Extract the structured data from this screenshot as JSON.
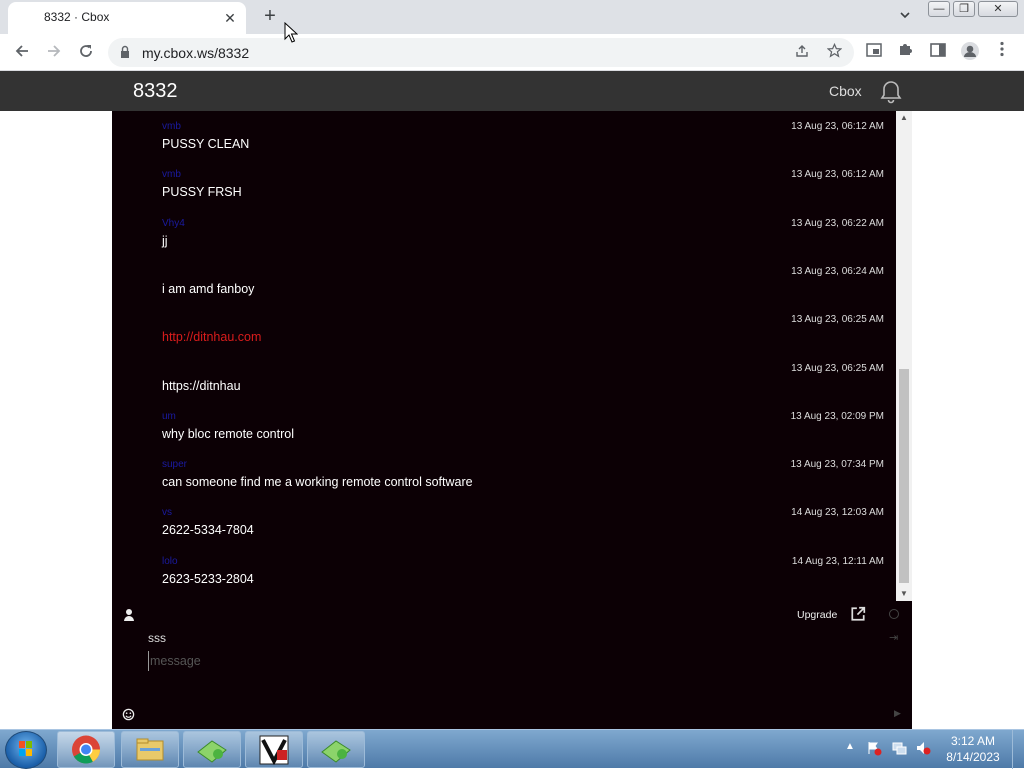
{
  "browser": {
    "tab_title": "8332 · Cbox",
    "tab_close": "✕",
    "new_tab": "+",
    "tab_search": "⌄",
    "url": "my.cbox.ws/8332",
    "window_controls": [
      "—",
      "❐",
      "✕"
    ]
  },
  "site": {
    "title": "8332",
    "brand": "Cbox"
  },
  "messages": [
    {
      "name": "vmb",
      "time": "13 Aug 23, 06:12 AM",
      "text": "PUSSY CLEAN",
      "is_link": false
    },
    {
      "name": "vmb",
      "time": "13 Aug 23, 06:12 AM",
      "text": "PUSSY FRSH",
      "is_link": false
    },
    {
      "name": "Vhy4",
      "time": "13 Aug 23, 06:22 AM",
      "text": "jj",
      "is_link": false
    },
    {
      "name": "",
      "time": "13 Aug 23, 06:24 AM",
      "text": "i am amd fanboy",
      "is_link": false
    },
    {
      "name": "",
      "time": "13 Aug 23, 06:25 AM",
      "text": "http://ditnhau.com",
      "is_link": true
    },
    {
      "name": "",
      "time": "13 Aug 23, 06:25 AM",
      "text": "https://ditnhau",
      "is_link": false
    },
    {
      "name": "um",
      "time": "13 Aug 23, 02:09 PM",
      "text": "why bloc remote control",
      "is_link": false
    },
    {
      "name": "super",
      "time": "13 Aug 23, 07:34 PM",
      "text": "can someone find me a working remote control software",
      "is_link": false
    },
    {
      "name": "vs",
      "time": "14 Aug 23, 12:03 AM",
      "text": "2622-5334-7804",
      "is_link": false
    },
    {
      "name": "lolo",
      "time": "14 Aug 23, 12:11 AM",
      "text": "2623-5233-2804",
      "is_link": false
    }
  ],
  "form": {
    "upgrade_label": "Upgrade",
    "name_value": "sss",
    "message_placeholder": "message"
  },
  "taskbar": {
    "time": "3:12 AM",
    "date": "8/14/2023"
  },
  "colors": {
    "link": "#d91c1c",
    "username": "#1a1aa0",
    "chat_bg": "#0c0005",
    "header_bg": "#333333"
  }
}
